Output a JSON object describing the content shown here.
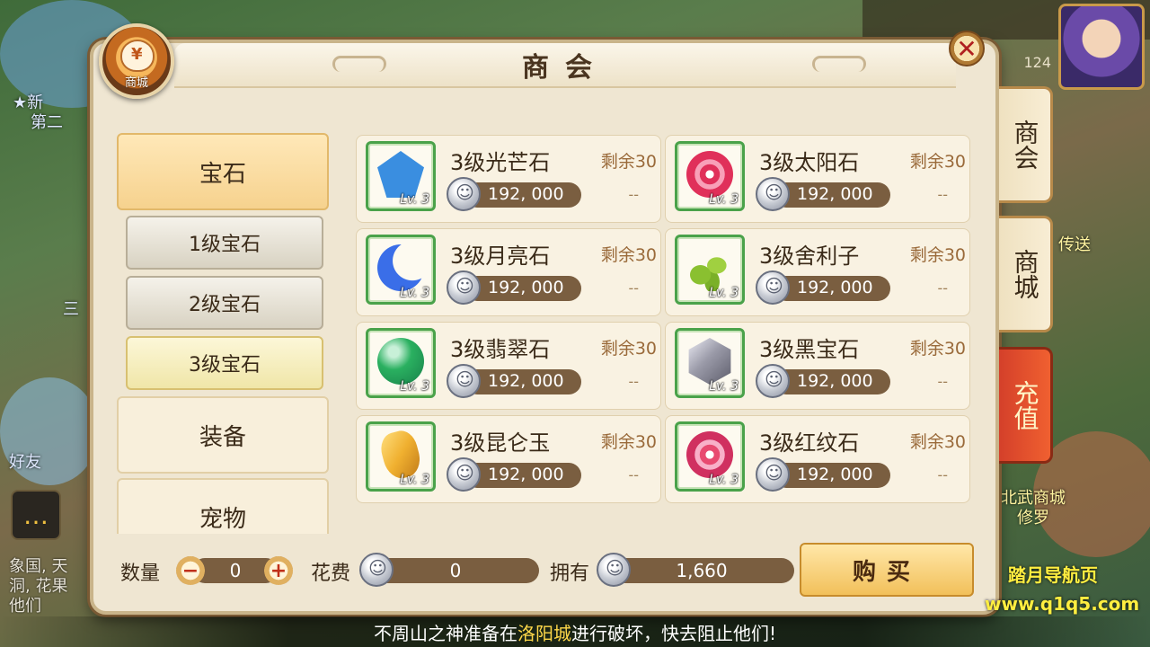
{
  "background": {
    "level_badge": "124",
    "left_texts": [
      "★新",
      "第二",
      "三",
      "好友"
    ],
    "right_texts": [
      "传送",
      "北武商城",
      "修罗"
    ],
    "chat_log": [
      "象国, 天",
      "洞, 花果",
      "他们"
    ]
  },
  "shop": {
    "title": "商会",
    "badge_label": "商城",
    "badge_symbol": "¥",
    "close_symbol": "✕"
  },
  "categories": [
    {
      "label": "宝石",
      "state": "active"
    },
    {
      "label": "1级宝石",
      "state": "sub"
    },
    {
      "label": "2级宝石",
      "state": "sub"
    },
    {
      "label": "3级宝石",
      "state": "sub-active"
    },
    {
      "label": "装备",
      "state": "normal"
    },
    {
      "label": "宠物",
      "state": "normal"
    }
  ],
  "items": [
    {
      "name": "3级光芒石",
      "remain": "剩余30",
      "price": "192, 000",
      "lv": "Lv. 3",
      "dash": "--",
      "gem_color": "#3a8ee0"
    },
    {
      "name": "3级太阳石",
      "remain": "剩余30",
      "price": "192, 000",
      "lv": "Lv. 3",
      "dash": "--",
      "gem_color": "#e0305a"
    },
    {
      "name": "3级月亮石",
      "remain": "剩余30",
      "price": "192, 000",
      "lv": "Lv. 3",
      "dash": "--",
      "gem_color": "#3a6ee8"
    },
    {
      "name": "3级舍利子",
      "remain": "剩余30",
      "price": "192, 000",
      "lv": "Lv. 3",
      "dash": "--",
      "gem_color": "#8ac030"
    },
    {
      "name": "3级翡翠石",
      "remain": "剩余30",
      "price": "192, 000",
      "lv": "Lv. 3",
      "dash": "--",
      "gem_color": "#2ab060"
    },
    {
      "name": "3级黑宝石",
      "remain": "剩余30",
      "price": "192, 000",
      "lv": "Lv. 3",
      "dash": "--",
      "gem_color": "#9a9aa8"
    },
    {
      "name": "3级昆仑玉",
      "remain": "剩余30",
      "price": "192, 000",
      "lv": "Lv. 3",
      "dash": "--",
      "gem_color": "#f0b030"
    },
    {
      "name": "3级红纹石",
      "remain": "剩余30",
      "price": "192, 000",
      "lv": "Lv. 3",
      "dash": "--",
      "gem_color": "#e84a70"
    }
  ],
  "bottom": {
    "qty_label": "数量",
    "qty_value": "0",
    "minus": "−",
    "plus": "+",
    "cost_label": "花费",
    "cost_value": "0",
    "own_label": "拥有",
    "own_value": "1,660",
    "buy_label": "购买"
  },
  "side_tabs": [
    "商会",
    "商城",
    "充值"
  ],
  "marquee": {
    "prefix": "不周山之神准备在",
    "highlight": "洛阳城",
    "suffix": "进行破坏，快去阻止他们!"
  },
  "watermark": {
    "line1": "踏月导航页",
    "line2": "www.q1q5.com"
  }
}
